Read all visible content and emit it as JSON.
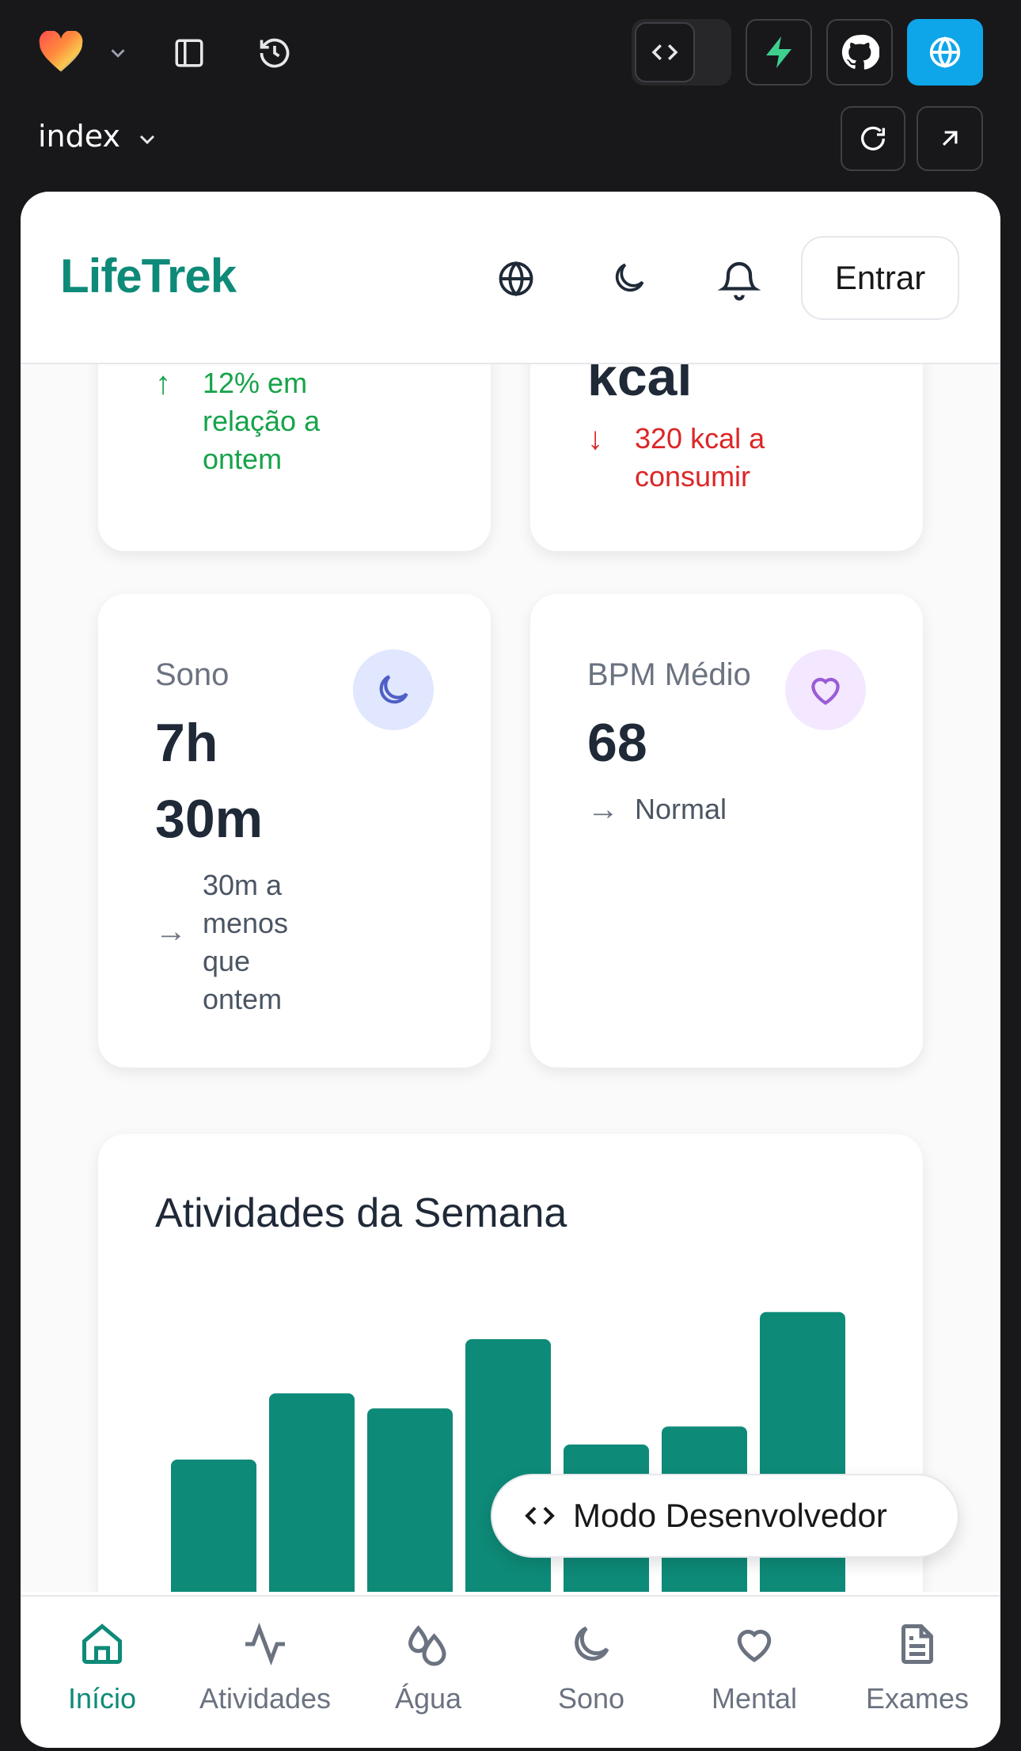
{
  "editor": {
    "page_selector": "index",
    "colors": {
      "bg": "#18181b",
      "accent": "#0ea5e9",
      "supabase": "#3ecf8e"
    },
    "icons": [
      "heart-logo-icon",
      "chevron-down-icon",
      "sidebar-icon",
      "history-icon",
      "code-icon",
      "supabase-icon",
      "github-icon",
      "globe-icon",
      "refresh-icon",
      "external-link-icon"
    ]
  },
  "app": {
    "brand": "LifeTrek",
    "brand_color": "#0e8a78",
    "login_label": "Entrar"
  },
  "cards": {
    "steps": {
      "trend_text": "12% em relação a ontem",
      "trend_color": "#16a34a"
    },
    "calories": {
      "value_unit": "kcal",
      "trend_text": "320 kcal a consumir",
      "trend_color": "#dc2626"
    },
    "sleep": {
      "label": "Sono",
      "value_line1": "7h",
      "value_line2": "30m",
      "trend_text": "30m a menos que ontem"
    },
    "bpm": {
      "label": "BPM Médio",
      "value": "68",
      "trend_text": "Normal"
    }
  },
  "weekly": {
    "title": "Atividades da Semana"
  },
  "chart_data": {
    "type": "bar",
    "title": "Atividades da Semana",
    "categories": [],
    "values": [
      45,
      67,
      62,
      85,
      50,
      56,
      94
    ],
    "color": "#0e8a78"
  },
  "dev_mode_label": "Modo Desenvolvedor",
  "nav": {
    "items": [
      {
        "label": "Início",
        "icon": "home-icon",
        "active": true
      },
      {
        "label": "Atividades",
        "icon": "activity-icon"
      },
      {
        "label": "Água",
        "icon": "droplets-icon"
      },
      {
        "label": "Sono",
        "icon": "moon-icon"
      },
      {
        "label": "Mental",
        "icon": "heart-icon"
      },
      {
        "label": "Exames",
        "icon": "file-text-icon"
      }
    ]
  }
}
